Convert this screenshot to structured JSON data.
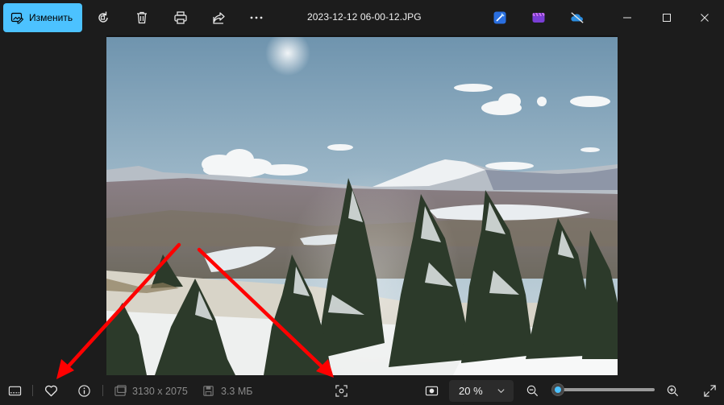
{
  "toolbar": {
    "edit_label": "Изменить",
    "icons": [
      "edit-image-icon",
      "rotate-icon",
      "delete-icon",
      "print-icon",
      "share-icon",
      "more-icon"
    ]
  },
  "window": {
    "title": "2023-12-12 06-00-12.JPG",
    "app_icons": [
      "designer-icon",
      "clipchamp-icon",
      "onedrive-offline-icon"
    ],
    "controls": [
      "minimize-icon",
      "maximize-icon",
      "close-icon"
    ]
  },
  "statusbar": {
    "dimensions": "3130 x 2075",
    "file_size": "3.3 МБ",
    "zoom_value": "20 %",
    "zoom_level_fraction": 0.05
  },
  "colors": {
    "accent": "#4cc2ff",
    "background": "#1c1c1c",
    "annotation_arrow": "#ff0000"
  }
}
